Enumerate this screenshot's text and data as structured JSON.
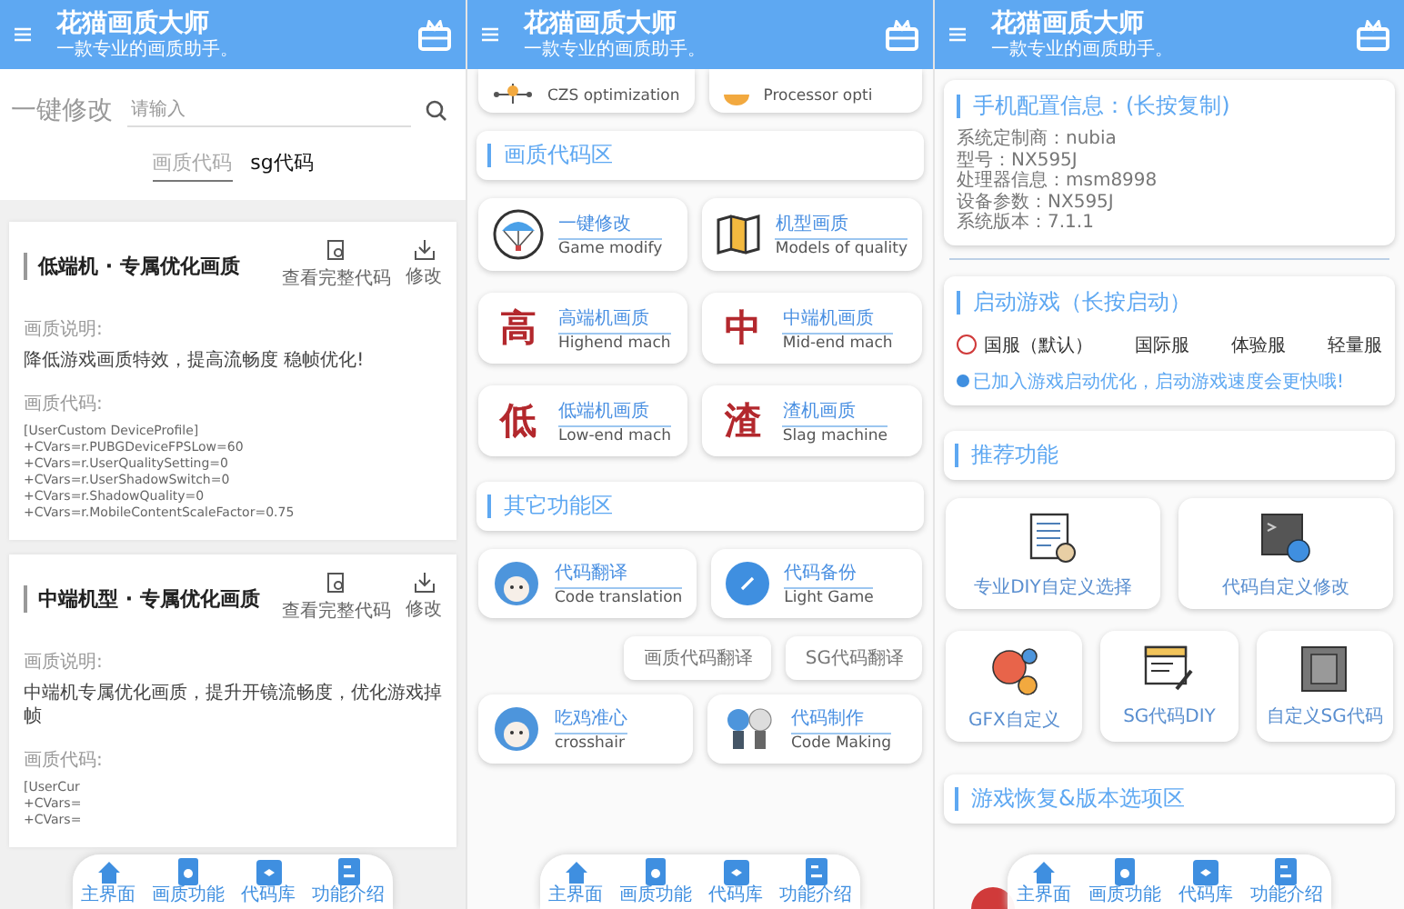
{
  "screens": [
    {
      "kind": "codes",
      "header": {
        "title": "花猫画质大师",
        "subtitle": "一款专业的画质助手。"
      },
      "search": {
        "label": "一键修改",
        "placeholder": "请输入"
      },
      "tabs": [
        {
          "label": "画质代码",
          "selected": true
        },
        {
          "label": "sg代码",
          "selected": false
        }
      ],
      "cards": [
        {
          "title": "低端机 · 专属优化画质",
          "actions": [
            "查看完整代码",
            "修改"
          ],
          "desc_label": "画质说明:",
          "desc": "降低游戏画质特效，提高流畅度 稳帧优化!",
          "code_label": "画质代码:",
          "code": [
            "[UserCustom DeviceProfile]",
            "+CVars=r.PUBGDeviceFPSLow=60",
            "+CVars=r.UserQualitySetting=0",
            "+CVars=r.UserShadowSwitch=0",
            "+CVars=r.ShadowQuality=0",
            "+CVars=r.MobileContentScaleFactor=0.75"
          ]
        },
        {
          "title": "中端机型 · 专属优化画质",
          "actions": [
            "查看完整代码",
            "修改"
          ],
          "desc_label": "画质说明:",
          "desc": "中端机专属优化画质，提升开镜流畅度，优化游戏掉帧",
          "code_label": "画质代码:",
          "code": [
            "[UserCur",
            "+CVars=",
            "+CVars="
          ]
        }
      ],
      "nav": [
        "主界面",
        "画质功能",
        "代码库",
        "功能介绍"
      ]
    },
    {
      "kind": "menu",
      "header": {
        "title": "花猫画质大师",
        "subtitle": "一款专业的画质助手。"
      },
      "top_tiles": [
        "CZS optimization",
        "Processor opti"
      ],
      "sections": [
        {
          "title": "画质代码区",
          "tiles": [
            {
              "title": "一键修改",
              "subtitle": "Game modify"
            },
            {
              "title": "机型画质",
              "subtitle": "Models of quality"
            },
            {
              "glyph": "高",
              "title": "高端机画质",
              "subtitle": "Highend mach"
            },
            {
              "glyph": "中",
              "title": "中端机画质",
              "subtitle": "Mid-end mach"
            },
            {
              "glyph": "低",
              "title": "低端机画质",
              "subtitle": "Low-end mach"
            },
            {
              "glyph": "渣",
              "title": "渣机画质",
              "subtitle": "Slag machine"
            }
          ]
        },
        {
          "title": "其它功能区",
          "tiles": [
            {
              "title": "代码翻译",
              "subtitle": "Code translation"
            },
            {
              "title": "代码备份",
              "subtitle": "Light Game"
            }
          ],
          "links": [
            "画质代码翻译",
            "SG代码翻译"
          ],
          "more_tiles": [
            {
              "title": "吃鸡准心",
              "subtitle": "crosshair"
            },
            {
              "title": "代码制作",
              "subtitle": "Code Making"
            }
          ]
        }
      ],
      "nav": [
        "主界面",
        "画质功能",
        "代码库",
        "功能介绍"
      ]
    },
    {
      "kind": "info",
      "header": {
        "title": "花猫画质大师",
        "subtitle": "一款专业的画质助手。"
      },
      "device": {
        "title": "手机配置信息：(长按复制)",
        "lines": [
          "系统定制商：nubia",
          "型号：NX595J",
          "处理器信息：msm8998",
          "设备参数：NX595J",
          "系统版本：7.1.1"
        ]
      },
      "launch": {
        "title": "启动游戏（长按启动）",
        "options": [
          {
            "kind": "radio",
            "label": "国服（默认）",
            "selected": false
          },
          {
            "kind": "plain",
            "label": "国际服",
            "selected": false
          },
          {
            "kind": "plain",
            "label": "体验服",
            "selected": false
          },
          {
            "kind": "plain",
            "label": "轻量服",
            "selected": false
          }
        ],
        "note": "已加入游戏启动优化，启动游戏速度会更快哦!"
      },
      "recommend": {
        "title": "推荐功能",
        "large_cards": [
          "专业DIY自定义选择",
          "代码自定义修改"
        ],
        "small_cards": [
          "GFX自定义",
          "SG代码DIY",
          "自定义SG代码"
        ]
      },
      "restore": {
        "title": "游戏恢复&版本选项区"
      },
      "nav": [
        "主界面",
        "画质功能",
        "代码库",
        "功能介绍"
      ]
    }
  ]
}
